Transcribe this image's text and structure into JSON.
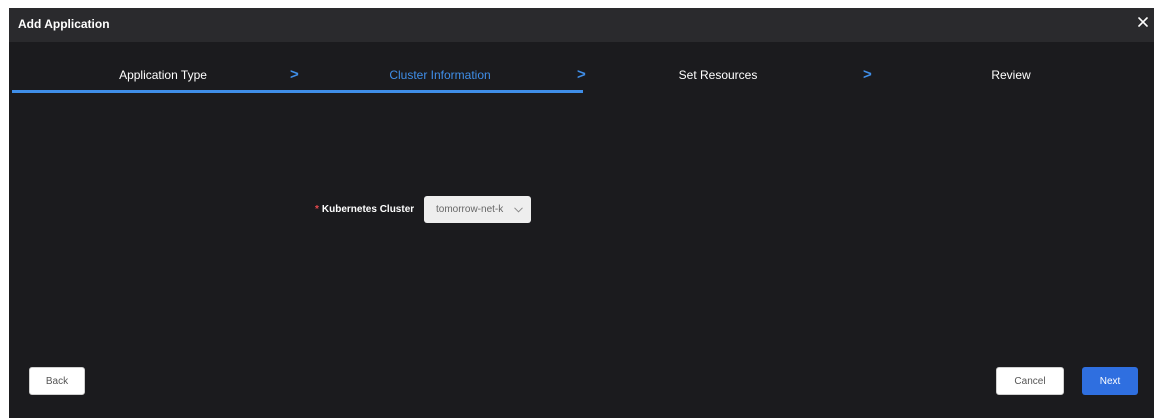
{
  "dialog": {
    "title": "Add Application",
    "close_icon": "close-icon"
  },
  "steps": [
    {
      "label": "Application Type",
      "state": "done"
    },
    {
      "label": "Cluster Information",
      "state": "active"
    },
    {
      "label": "Set Resources",
      "state": "pending"
    },
    {
      "label": "Review",
      "state": "pending"
    }
  ],
  "separator": ">",
  "form": {
    "required_mark": "*",
    "cluster_label": "Kubernetes Cluster",
    "cluster_value": "tomorrow-net-k",
    "cluster_select_icon": "chevron-down-icon"
  },
  "footer": {
    "back_label": "Back",
    "cancel_label": "Cancel",
    "next_label": "Next"
  },
  "colors": {
    "background": "#1b1b1e",
    "titlebar": "#2a2a2d",
    "accent": "#3f8ee8",
    "primary_button": "#2f6fe0",
    "required": "#e5484d"
  }
}
